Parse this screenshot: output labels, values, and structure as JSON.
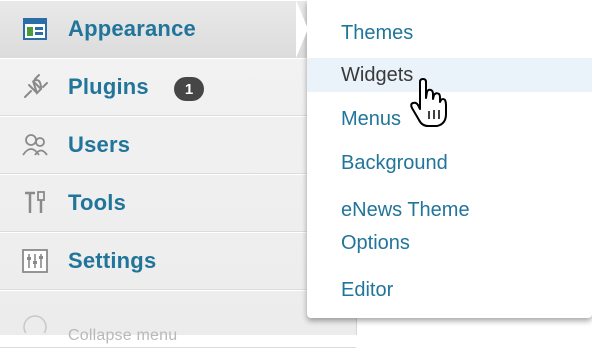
{
  "menu": {
    "items": [
      {
        "label": "Appearance",
        "icon": "appearance-icon"
      },
      {
        "label": "Plugins",
        "icon": "plugins-icon",
        "badge": "1"
      },
      {
        "label": "Users",
        "icon": "users-icon"
      },
      {
        "label": "Tools",
        "icon": "tools-icon"
      },
      {
        "label": "Settings",
        "icon": "settings-icon"
      },
      {
        "label": "Collapse menu",
        "icon": "collapse-icon"
      }
    ]
  },
  "submenu": {
    "items": [
      {
        "label": "Themes"
      },
      {
        "label": "Widgets",
        "state": "hover"
      },
      {
        "label": "Menus"
      },
      {
        "label": "Background"
      },
      {
        "label": "eNews Theme Options"
      },
      {
        "label": "Editor"
      }
    ]
  },
  "colors": {
    "link": "#21759b",
    "menu_bg": "#f1f1f1",
    "hover_bg": "#eaf2fa",
    "badge_bg": "#464646"
  },
  "cursor": {
    "type": "hand-pointer-cursor"
  }
}
